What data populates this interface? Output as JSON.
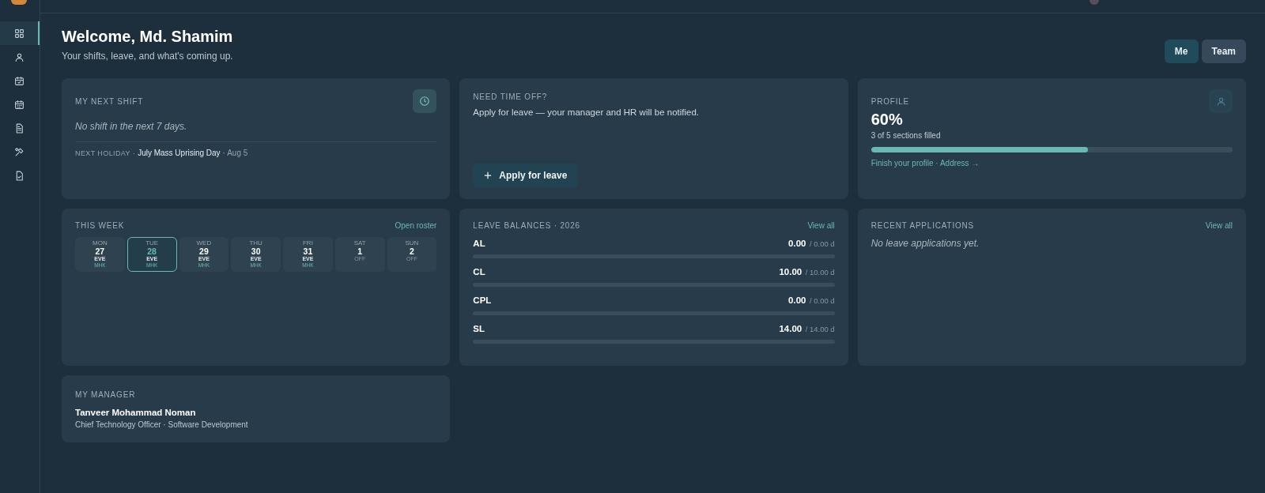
{
  "sidebar": {
    "items": [
      {
        "selected": true
      },
      {
        "selected": false
      },
      {
        "selected": false
      },
      {
        "selected": false
      },
      {
        "selected": false
      },
      {
        "selected": false
      },
      {
        "selected": false
      }
    ]
  },
  "header": {
    "title": "Welcome, Md. Shamim",
    "subtitle": "Your shifts, leave, and what's coming up."
  },
  "view_tabs": [
    {
      "label": "Me",
      "selected": true
    },
    {
      "label": "Team",
      "selected": false
    }
  ],
  "next_shift": {
    "title": "MY NEXT SHIFT",
    "empty": "No shift in the next 7 days.",
    "holiday_label": "NEXT HOLIDAY ·",
    "holiday_name": "July Mass Uprising Day",
    "holiday_date": "· Aug 5"
  },
  "time_off": {
    "title": "NEED TIME OFF?",
    "text": "Apply for leave — your manager and HR will be notified.",
    "button": "Apply for leave"
  },
  "profile": {
    "title": "PROFILE",
    "percent": "60%",
    "sections": "3 of 5 sections filled",
    "level": 0.6,
    "link": "Finish your profile · Address →"
  },
  "this_week": {
    "title": "THIS WEEK",
    "link": "Open roster",
    "days": [
      {
        "day": "MON",
        "date": "27",
        "kind": "shift",
        "shift": "EVE",
        "site": "MHK",
        "selected": false
      },
      {
        "day": "TUE",
        "date": "28",
        "kind": "shift",
        "shift": "EVE",
        "site": "MHK",
        "selected": true
      },
      {
        "day": "WED",
        "date": "29",
        "kind": "shift",
        "shift": "EVE",
        "site": "MHK",
        "selected": false
      },
      {
        "day": "THU",
        "date": "30",
        "kind": "shift",
        "shift": "EVE",
        "site": "MHK",
        "selected": false
      },
      {
        "day": "FRI",
        "date": "31",
        "kind": "shift",
        "shift": "EVE",
        "site": "MHK",
        "selected": false
      },
      {
        "day": "SAT",
        "date": "1",
        "kind": "off",
        "shift": "OFF",
        "selected": false
      },
      {
        "day": "SUN",
        "date": "2",
        "kind": "off",
        "shift": "OFF",
        "selected": false
      }
    ]
  },
  "leave_balances": {
    "title": "LEAVE BALANCES · 2026",
    "link": "View all",
    "rows": [
      {
        "type": "AL",
        "balance": "0.00",
        "total": "/ 0.00 d"
      },
      {
        "type": "CL",
        "balance": "10.00",
        "total": "/ 10.00 d"
      },
      {
        "type": "CPL",
        "balance": "0.00",
        "total": "/ 0.00 d"
      },
      {
        "type": "SL",
        "balance": "14.00",
        "total": "/ 14.00 d"
      }
    ]
  },
  "recent_applications": {
    "title": "RECENT APPLICATIONS",
    "link": "View all",
    "empty": "No leave applications yet."
  },
  "manager": {
    "title": "MY MANAGER",
    "name": "Tanveer Mohammad Noman",
    "role": "Chief Technology Officer · Software Development"
  }
}
